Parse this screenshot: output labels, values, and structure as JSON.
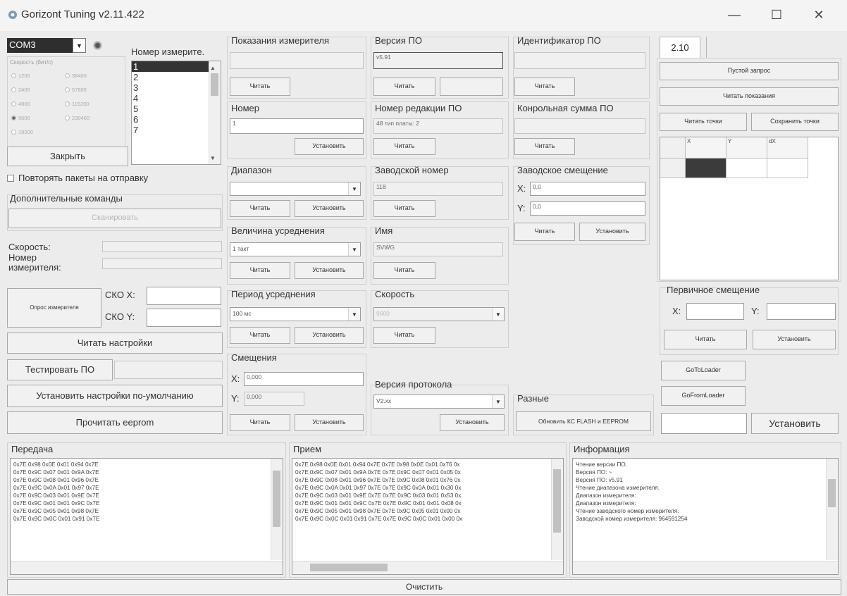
{
  "window": {
    "title": "Gorizont Tuning v2.11.422",
    "minimize": "—",
    "maximize": "☐",
    "close": "✕"
  },
  "connection": {
    "port": "COM3",
    "speed_label": "Скорость (бит/с)",
    "speeds": [
      "1200",
      "2400",
      "4800",
      "9600",
      "19200",
      "38400",
      "57600",
      "115200",
      "230400"
    ],
    "selected_speed": "9600",
    "close_button": "Закрыть",
    "meter_number_label": "Номер измерите.",
    "meter_numbers": [
      "1",
      "2",
      "3",
      "4",
      "5",
      "6",
      "7"
    ]
  },
  "left": {
    "repeat_packets": "Повторять пакеты на отправку",
    "extra_commands": "Дополнительные команды",
    "scan_button": "Сканировать",
    "speed_label": "Скорость:",
    "meter_number_label_1": "Номер",
    "meter_number_label_2": "измерителя:",
    "poll_button": "Опрос измерителя",
    "sko_x": "СКО X:",
    "sko_y": "СКО Y:",
    "read_settings": "Читать настройки",
    "test_fw": "Тестировать ПО",
    "set_defaults": "Установить настройки по-умолчанию",
    "read_eeprom": "Прочитать eeprom"
  },
  "common": {
    "read": "Читать",
    "set": "Установить"
  },
  "col1": {
    "readings_label": "Показания измерителя",
    "number_label": "Номер",
    "number_value": "1",
    "range_label": "Диапазон",
    "averaging_value_label": "Величина усреднения",
    "averaging_value": "1 такт",
    "averaging_period_label": "Период усреднения",
    "averaging_period": "100 мс",
    "offsets_label": "Смещения",
    "offset_x_label": "X:",
    "offset_x": "0,000",
    "offset_y_label": "Y:",
    "offset_y": "0,000"
  },
  "col2": {
    "fw_version_label": "Версия ПО",
    "fw_version": "v5.91",
    "revision_label": "Номер редакции ПО",
    "revision": "48 тип платы: 2",
    "serial_label": "Заводской номер",
    "serial": "118",
    "name_label": "Имя",
    "name": "SVWG",
    "speed_label": "Скорость",
    "speed": "9600",
    "protocol_label": "Версия протокола",
    "protocol": "V2.xx"
  },
  "col3": {
    "fw_id_label": "Идентификатор ПО",
    "checksum_label": "Конрольная сумма ПО",
    "factory_offset_label": "Заводское смещение",
    "fo_x_label": "X:",
    "fo_x": "0,0",
    "fo_y_label": "Y:",
    "fo_y": "0,0",
    "misc_label": "Разные",
    "update_button": "Обновить КС FLASH и EEPROM"
  },
  "right": {
    "tab": "2.10",
    "empty_request": "Пустой запрос",
    "read_readings": "Читать показания",
    "read_points": "Читать точки",
    "save_points": "Сохранить точки",
    "grid_headers": [
      "X",
      "Y",
      "dX"
    ],
    "primary_offset_label": "Первичное смещение",
    "po_x_label": "X:",
    "po_y_label": "Y:",
    "goto_loader": "GoToLoader",
    "gofrom_loader": "GoFromLoader",
    "set_button": "Установить"
  },
  "bottom": {
    "tx_label": "Передача",
    "rx_label": "Прием",
    "info_label": "Информация",
    "tx_lines": [
      "0x7E 0x98 0x0E 0x01 0x94 0x7E",
      "0x7E 0x9C 0x07 0x01 0x9A 0x7E",
      "0x7E 0x9C 0x08 0x01 0x96 0x7E",
      "0x7E 0x9C 0x0A 0x01 0x97 0x7E",
      "0x7E 0x9C 0x03 0x01 0x9E 0x7E",
      "0x7E 0x9C 0x01 0x01 0x9C 0x7E",
      "0x7E 0x9C 0x05 0x01 0x98 0x7E",
      "0x7E 0x9C 0x0C 0x01 0x91 0x7E"
    ],
    "rx_lines": [
      "0x7E 0x98 0x0E 0x01 0x94 0x7E 0x7E 0x98 0x0E 0x01 0x76 0x",
      "0x7E 0x9C 0x07 0x01 0x9A 0x7E 0x7E 0x9C 0x07 0x01 0x05 0x",
      "0x7E 0x9C 0x08 0x01 0x96 0x7E 0x7E 0x9C 0x08 0x01 0x76 0x",
      "0x7E 0x9C 0x0A 0x01 0x97 0x7E 0x7E 0x9C 0x0A 0x01 0x30 0x",
      "0x7E 0x9C 0x03 0x01 0x9E 0x7E 0x7E 0x9C 0x03 0x01 0x53 0x",
      "0x7E 0x9C 0x01 0x01 0x9C 0x7E 0x7E 0x9C 0x01 0x01 0x08 0x",
      "0x7E 0x9C 0x05 0x01 0x98 0x7E 0x7E 0x9C 0x05 0x01 0x00 0x",
      "0x7E 0x9C 0x0C 0x01 0x91 0x7E 0x7E 0x9C 0x0C 0x01 0x00 0x"
    ],
    "info_lines": [
      "Чтение версии ПО.",
      "Версия ПО: ~",
      "Версия ПО: v5.91",
      "Чтение диапазона измерителя.",
      "Диапазон измерителя:",
      "Диапазон измерителя:",
      "Чтение заводского номер измерителя.",
      "Заводской номер измерителя: 964591254"
    ],
    "clear": "Очистить"
  }
}
